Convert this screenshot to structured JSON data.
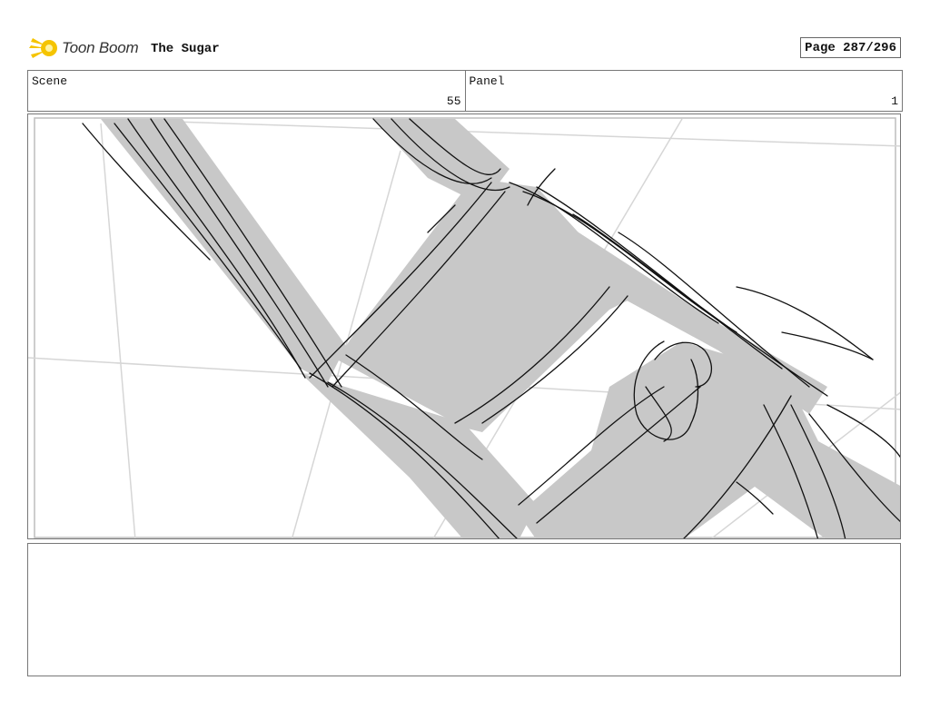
{
  "header": {
    "logo_text": "Toon Boom",
    "logo_icon": "toon-boom-star-icon",
    "project_title": "The Sugar",
    "page_label": "Page 287/296"
  },
  "info": {
    "scene_label": "Scene",
    "scene_value": "55",
    "panel_label": "Panel",
    "panel_value": "1"
  },
  "panel": {
    "image_description_icon": "storyboard-sketch",
    "fill_color": "#c8c8c8",
    "line_color": "#111111",
    "guide_color": "#d6d6d6"
  },
  "notes": {
    "text": ""
  },
  "colors": {
    "logo_yellow": "#f5c400",
    "border": "#777777"
  }
}
